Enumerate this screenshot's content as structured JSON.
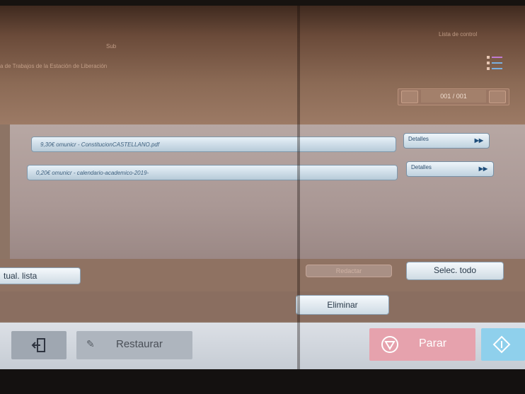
{
  "header": {
    "user_label": "Sub",
    "path_text": "a de Trabajos de la Estación de Liberación",
    "right_label": "Lista de control",
    "pager": {
      "count": "001 / 001"
    }
  },
  "files": [
    {
      "name": "9,30€ omunicr - ConstitucionCASTELLANO.pdf",
      "details_label": "Detalles"
    },
    {
      "name": "0,20€ omunicr - calendario-academico-2019-",
      "details_label": "Detalles"
    }
  ],
  "actions": {
    "list_label": "tual. lista",
    "redact_label": "Redactar",
    "select_all_label": "Selec. todo",
    "delete_label": "Eliminar"
  },
  "bottom": {
    "restore_label": "Restaurar",
    "stop_label": "Parar"
  },
  "colors": {
    "stop": "#e6a2ad",
    "start": "#8fd0ec",
    "button_text": "#2d4e6e"
  },
  "icons": {
    "logout": "logout-icon",
    "pencil": "pencil-icon",
    "stop": "stop-icon",
    "start": "start-icon",
    "list_view": "list-view-icon"
  }
}
